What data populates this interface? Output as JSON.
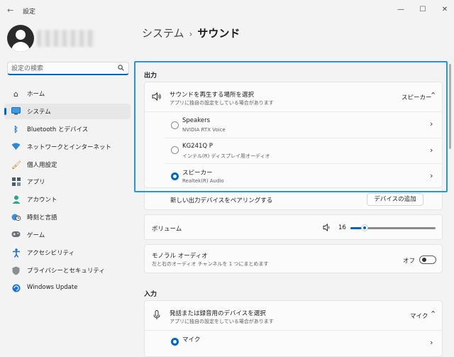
{
  "window": {
    "title": "設定",
    "minimize": "—",
    "maximize": "☐",
    "close": "✕"
  },
  "search": {
    "placeholder": "設定の検索"
  },
  "sidebar": {
    "items": [
      {
        "label": "ホーム",
        "icon": "home-icon"
      },
      {
        "label": "システム",
        "icon": "system-icon",
        "selected": true
      },
      {
        "label": "Bluetooth とデバイス",
        "icon": "bluetooth-icon"
      },
      {
        "label": "ネットワークとインターネット",
        "icon": "wifi-icon"
      },
      {
        "label": "個人用設定",
        "icon": "brush-icon"
      },
      {
        "label": "アプリ",
        "icon": "apps-icon"
      },
      {
        "label": "アカウント",
        "icon": "account-icon"
      },
      {
        "label": "時刻と言語",
        "icon": "globe-clock-icon"
      },
      {
        "label": "ゲーム",
        "icon": "gamepad-icon"
      },
      {
        "label": "アクセシビリティ",
        "icon": "accessibility-icon"
      },
      {
        "label": "プライバシーとセキュリティ",
        "icon": "shield-icon"
      },
      {
        "label": "Windows Update",
        "icon": "update-icon"
      }
    ]
  },
  "breadcrumb": {
    "parent": "システム",
    "separator": "›",
    "current": "サウンド"
  },
  "output": {
    "heading": "出力",
    "choose_title": "サウンドを再生する場所を選択",
    "choose_sub": "アプリに独自の設定をしている場合があります",
    "choose_value": "スピーカー",
    "devices": [
      {
        "name": "Speakers",
        "detail": "NVIDIA RTX Voice",
        "selected": false
      },
      {
        "name": "KG241Q P",
        "detail": "インテル(R) ディスプレイ用オーディオ",
        "selected": false
      },
      {
        "name": "スピーカー",
        "detail": "Realtek(R) Audio",
        "selected": true
      }
    ],
    "pair_label": "新しい出力デバイスをペアリングする",
    "pair_button": "デバイスの追加",
    "volume_label": "ボリューム",
    "volume_value": "16",
    "mono_title": "モノラル オーディオ",
    "mono_sub": "左と右のオーディオ チャンネルを 1 つにまとめます",
    "mono_state": "オフ"
  },
  "input": {
    "heading": "入力",
    "choose_title": "発話または録音用のデバイスを選択",
    "choose_sub": "アプリに独自の設定をしている場合があります",
    "choose_value": "マイク",
    "devices": [
      {
        "name": "マイク",
        "selected": true
      }
    ]
  },
  "colors": {
    "accent": "#0067c0",
    "highlight": "#2196e8"
  }
}
